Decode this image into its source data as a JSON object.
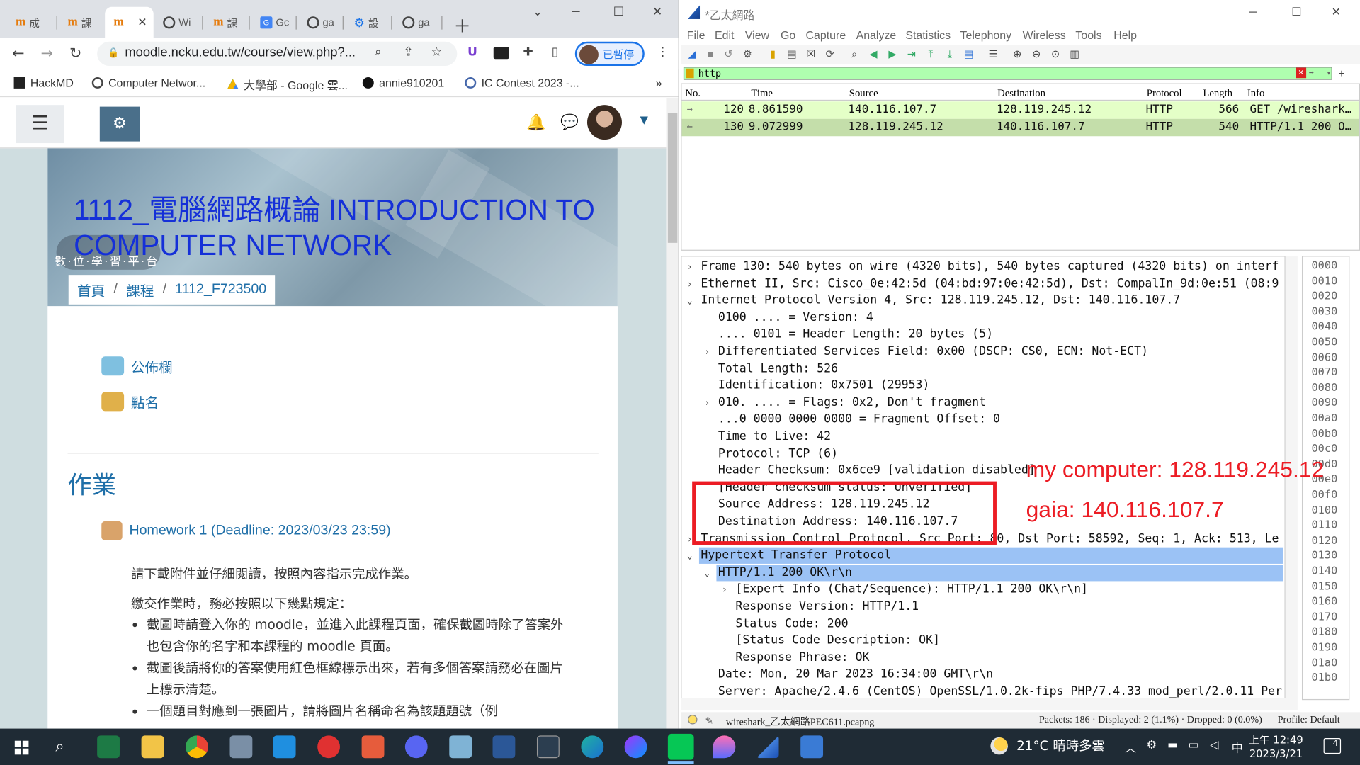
{
  "chrome": {
    "tabs": [
      {
        "label": "成",
        "icon": "moodle-icon"
      },
      {
        "label": "課",
        "icon": "moodle-icon"
      },
      {
        "label": "",
        "icon": "moodle-icon",
        "active": true
      },
      {
        "label": "Wi",
        "icon": "globe-icon"
      },
      {
        "label": "課",
        "icon": "moodle-icon"
      },
      {
        "label": "Gc",
        "icon": "translate-icon"
      },
      {
        "label": "ga",
        "icon": "globe-icon"
      },
      {
        "label": "設",
        "icon": "gear-icon"
      },
      {
        "label": "ga",
        "icon": "globe-icon"
      }
    ],
    "url": "moodle.ncku.edu.tw/course/view.php?...",
    "profile_label": "已暫停",
    "bookmarks": [
      "HackMD",
      "Computer Networ...",
      "大學部 - Google 雲...",
      "annie910201",
      "IC Contest 2023 -..."
    ]
  },
  "moodle": {
    "course_title": "1112_電腦網路概論 INTRODUCTION TO COMPUTER NETWORK",
    "banner_motto": "數·位·學·習·平·台",
    "breadcrumb": [
      "首頁",
      "課程",
      "1112_F723500"
    ],
    "activities": [
      "公佈欄",
      "點名"
    ],
    "section_heading": "作業",
    "homework_link": "Homework 1 (Deadline: 2023/03/23 23:59)",
    "para1": "請下載附件並仔細閱讀，按照內容指示完成作業。",
    "para2": "繳交作業時，務必按照以下幾點規定：",
    "rules": [
      "截圖時請登入你的 moodle，並進入此課程頁面，確保截圖時除了答案外也包含你的名字和本課程的 moodle 頁面。",
      "截圖後請將你的答案使用紅色框線標示出來，若有多個答案請務必在圖片上標示清楚。",
      "一個題目對應到一張圖片，請將圖片名稱命名為該題題號（例"
    ]
  },
  "wireshark": {
    "window_title": "*乙太網路",
    "menu": [
      "File",
      "Edit",
      "View",
      "Go",
      "Capture",
      "Analyze",
      "Statistics",
      "Telephony",
      "Wireless",
      "Tools",
      "Help"
    ],
    "filter_text": "http",
    "columns": [
      "No.",
      "Time",
      "Source",
      "Destination",
      "Protocol",
      "Length",
      "Info"
    ],
    "packets": [
      {
        "no": "120",
        "time": "8.861590",
        "src": "140.116.107.7",
        "dst": "128.119.245.12",
        "proto": "HTTP",
        "len": "566",
        "info": "GET /wireshark…"
      },
      {
        "no": "130",
        "time": "9.072999",
        "src": "128.119.245.12",
        "dst": "140.116.107.7",
        "proto": "HTTP",
        "len": "540",
        "info": "HTTP/1.1 200 O…"
      }
    ],
    "details": [
      {
        "text": "Frame 130: 540 bytes on wire (4320 bits), 540 bytes captured (4320 bits) on interf",
        "indent": 0,
        "exp": ">"
      },
      {
        "text": "Ethernet II, Src: Cisco_0e:42:5d (04:bd:97:0e:42:5d), Dst: CompalIn_9d:0e:51 (08:9",
        "indent": 0,
        "exp": ">"
      },
      {
        "text": "Internet Protocol Version 4, Src: 128.119.245.12, Dst: 140.116.107.7",
        "indent": 0,
        "exp": "v"
      },
      {
        "text": "0100 .... = Version: 4",
        "indent": 1,
        "exp": ""
      },
      {
        "text": ".... 0101 = Header Length: 20 bytes (5)",
        "indent": 1,
        "exp": ""
      },
      {
        "text": "Differentiated Services Field: 0x00 (DSCP: CS0, ECN: Not-ECT)",
        "indent": 1,
        "exp": ">"
      },
      {
        "text": "Total Length: 526",
        "indent": 1,
        "exp": ""
      },
      {
        "text": "Identification: 0x7501 (29953)",
        "indent": 1,
        "exp": ""
      },
      {
        "text": "010. .... = Flags: 0x2, Don't fragment",
        "indent": 1,
        "exp": ">"
      },
      {
        "text": "...0 0000 0000 0000 = Fragment Offset: 0",
        "indent": 1,
        "exp": ""
      },
      {
        "text": "Time to Live: 42",
        "indent": 1,
        "exp": ""
      },
      {
        "text": "Protocol: TCP (6)",
        "indent": 1,
        "exp": ""
      },
      {
        "text": "Header Checksum: 0x6ce9 [validation disabled]",
        "indent": 1,
        "exp": ""
      },
      {
        "text": "[Header checksum status: Unverified]",
        "indent": 1,
        "exp": ""
      },
      {
        "text": "Source Address: 128.119.245.12",
        "indent": 1,
        "exp": ""
      },
      {
        "text": "Destination Address: 140.116.107.7",
        "indent": 1,
        "exp": ""
      },
      {
        "text": "Transmission Control Protocol, Src Port: 80, Dst Port: 58592, Seq: 1, Ack: 513, Le",
        "indent": 0,
        "exp": ">"
      },
      {
        "text": "Hypertext Transfer Protocol",
        "indent": 0,
        "exp": "v",
        "sel": true
      },
      {
        "text": "HTTP/1.1 200 OK\\r\\n",
        "indent": 1,
        "exp": "v",
        "sel": true
      },
      {
        "text": "[Expert Info (Chat/Sequence): HTTP/1.1 200 OK\\r\\n]",
        "indent": 2,
        "exp": ">"
      },
      {
        "text": "Response Version: HTTP/1.1",
        "indent": 2,
        "exp": ""
      },
      {
        "text": "Status Code: 200",
        "indent": 2,
        "exp": ""
      },
      {
        "text": "[Status Code Description: OK]",
        "indent": 2,
        "exp": ""
      },
      {
        "text": "Response Phrase: OK",
        "indent": 2,
        "exp": ""
      },
      {
        "text": "Date: Mon, 20 Mar 2023 16:34:00 GMT\\r\\n",
        "indent": 1,
        "exp": ""
      },
      {
        "text": "Server: Apache/2.4.6 (CentOS) OpenSSL/1.0.2k-fips PHP/7.4.33 mod_perl/2.0.11 Per",
        "indent": 1,
        "exp": ""
      }
    ],
    "hex_offsets": [
      "0000",
      "0010",
      "0020",
      "0030",
      "0040",
      "0050",
      "0060",
      "0070",
      "0080",
      "0090",
      "00a0",
      "00b0",
      "00c0",
      "00d0",
      "00e0",
      "00f0",
      "0100",
      "0110",
      "0120",
      "0130",
      "0140",
      "0150",
      "0160",
      "0170",
      "0180",
      "0190",
      "01a0",
      "01b0"
    ],
    "status_file": "wireshark_乙太網路PEC611.pcapng",
    "status_packets": "Packets: 186 · Displayed: 2 (1.1%) · Dropped: 0 (0.0%)",
    "status_profile": "Profile: Default"
  },
  "annotations": {
    "my_computer": "my computer: 128.119.245.12",
    "gaia": "gaia: 140.116.107.7"
  },
  "taskbar": {
    "weather": "21°C  晴時多雲",
    "ime": "中",
    "time": "上午 12:49",
    "date": "2023/3/21",
    "notifications": "4"
  },
  "colors": {
    "annotation_red": "#ec1c24",
    "filter_green": "#afffaf",
    "packet_green": "#e4ffc7",
    "selected_blue": "#9bc2f5",
    "moodle_blue": "#1f6fa8"
  }
}
